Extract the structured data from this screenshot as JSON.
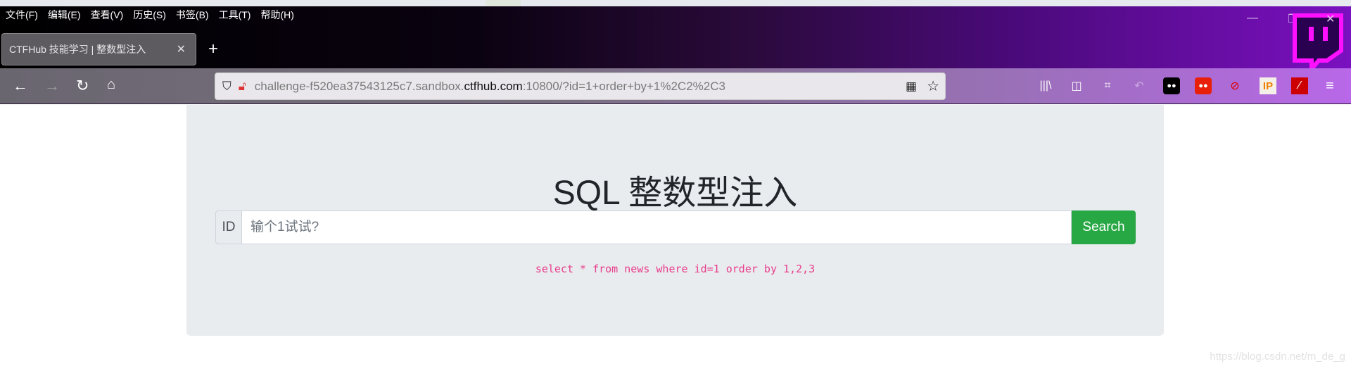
{
  "browser": {
    "menu": [
      "文件(F)",
      "编辑(E)",
      "查看(V)",
      "历史(S)",
      "书签(B)",
      "工具(T)",
      "帮助(H)"
    ],
    "tab_title": "CTFHub 技能学习 | 整数型注入",
    "url_prefix": "challenge-f520ea37543125c7.sandbox.",
    "url_host": "ctfhub.com",
    "url_suffix": ":10800/?id=1+order+by+1%2C2%2C3",
    "toolbar_icons": [
      "library-icon",
      "sidebar-icon",
      "crop-icon",
      "undo-icon",
      "tampermonkey-icon",
      "tampermonkey-red-icon",
      "blocked-extension-icon",
      "ip-icon",
      "hackbar-icon",
      "menu-icon"
    ],
    "ip_label": "IP"
  },
  "page": {
    "title": "SQL 整数型注入",
    "id_label": "ID",
    "input_placeholder": "输个1试试?",
    "search_label": "Search",
    "query": "select * from news where id=1 order by 1,2,3"
  },
  "watermark": "https://blog.csdn.net/m_de_g"
}
